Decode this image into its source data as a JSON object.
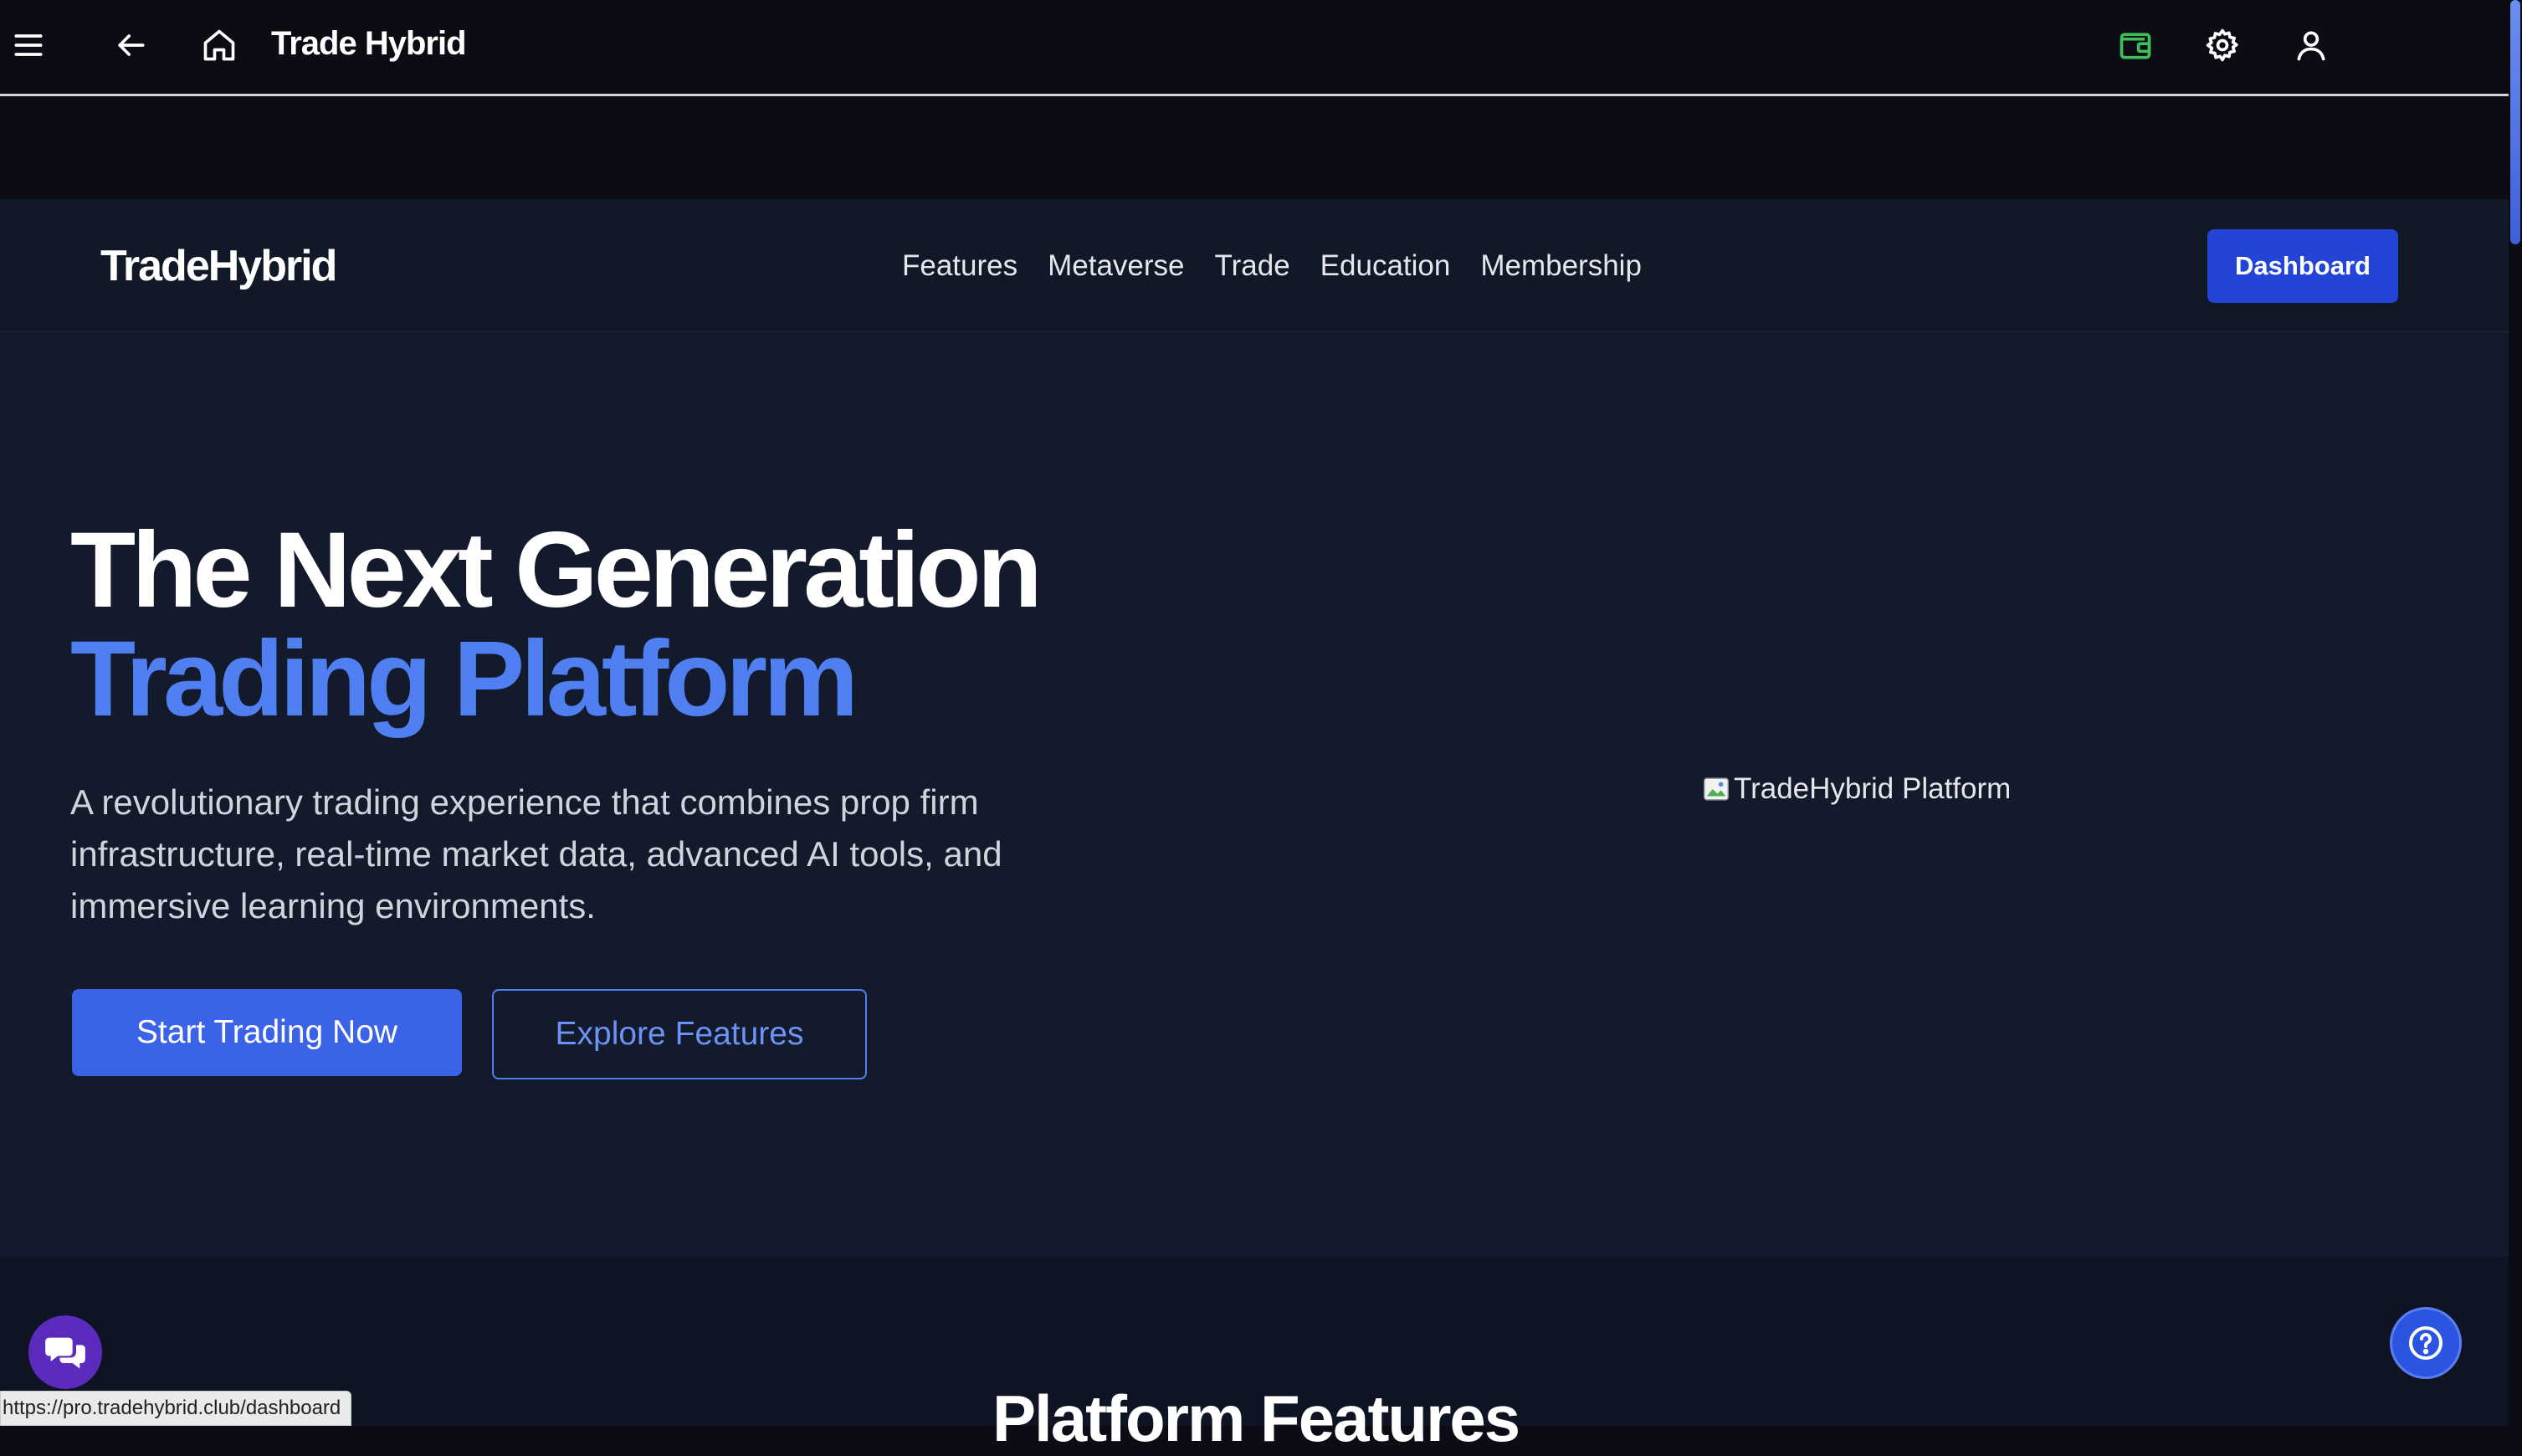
{
  "topbar": {
    "title": "Trade Hybrid",
    "icons": [
      "menu-icon",
      "back-arrow-icon",
      "home-icon",
      "wallet-icon",
      "settings-icon",
      "user-icon"
    ],
    "wallet_color": "#3fbf5a"
  },
  "navbar": {
    "logo": "TradeHybrid",
    "links": [
      "Features",
      "Metaverse",
      "Trade",
      "Education",
      "Membership"
    ],
    "dashboard_label": "Dashboard"
  },
  "hero": {
    "title_line1": "The Next Generation",
    "title_line2": "Trading Platform",
    "description": "A revolutionary trading experience that combines prop firm infrastructure, real-time market data, advanced AI tools, and immersive learning environments.",
    "primary_cta": "Start Trading Now",
    "secondary_cta": "Explore Features",
    "image_alt": "TradeHybrid Platform",
    "accent_color": "#4f7ff0"
  },
  "features": {
    "title": "Platform Features"
  },
  "widgets": {
    "chat_icon": "chat-bubbles-icon",
    "help_icon": "question-circle-icon"
  },
  "status_bar": {
    "url": "https://pro.tradehybrid.club/dashboard"
  }
}
